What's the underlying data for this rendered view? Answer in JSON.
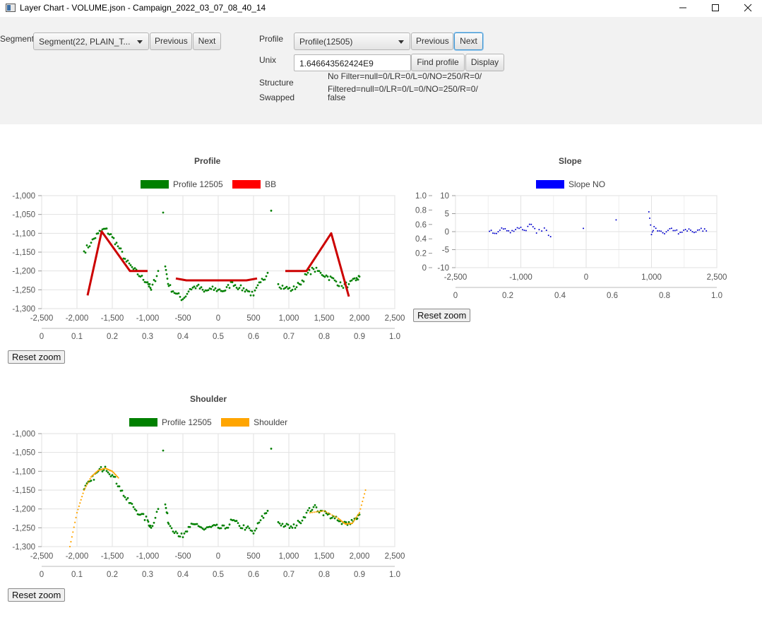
{
  "window": {
    "title": "Layer Chart - VOLUME.json - Campaign_2022_03_07_08_40_14",
    "minimize": "—",
    "maximize": "☐",
    "close": "✕"
  },
  "segment": {
    "label": "Segment",
    "selected": "Segment(22, PLAIN_T...",
    "prev": "Previous",
    "next": "Next"
  },
  "profile": {
    "label": "Profile",
    "selected": "Profile(12505)",
    "prev": "Previous",
    "next": "Next",
    "unix_label": "Unix",
    "unix_value": "1.646643562424E9",
    "find": "Find profile",
    "display": "Display",
    "structure_label": "Structure",
    "structure_line1": "No Filter=null=0/LR=0/L=0/NO=250/R=0/",
    "structure_line2": "Filtered=null=0/LR=0/L=0/NO=250/R=0/",
    "swapped_label": "Swapped",
    "swapped_value": "false"
  },
  "charts": {
    "reset_label": "Reset zoom",
    "profile": {
      "title": "Profile",
      "legend": [
        {
          "name": "Profile 12505",
          "color": "#008000"
        },
        {
          "name": "BB",
          "color": "#ff0000"
        }
      ],
      "y_ticks": [
        "-1,000",
        "-1,050",
        "-1,100",
        "-1,150",
        "-1,200",
        "-1,250",
        "-1,300"
      ],
      "x_ticks": [
        "-2,500",
        "-2,000",
        "-1,500",
        "-1,000",
        "-500",
        "0",
        "500",
        "1,000",
        "1,500",
        "2,000",
        "2,500"
      ],
      "x2_ticks": [
        "0",
        "0.1",
        "0.2",
        "0.3",
        "0.4",
        "0.5",
        "0.6",
        "0.7",
        "0.8",
        "0.9",
        "1.0"
      ]
    },
    "slope": {
      "title": "Slope",
      "legend": [
        {
          "name": "Slope NO",
          "color": "#0000ff"
        }
      ],
      "y_ticks": [
        "10",
        "5",
        "0",
        "-5",
        "-10"
      ],
      "y2_ticks": [
        "1.0",
        "0.8",
        "0.6",
        "0.4",
        "0.2",
        "0"
      ],
      "x_ticks": [
        "-2,500",
        "-1,000",
        "0",
        "1,000",
        "2,500"
      ],
      "x2_ticks": [
        "0",
        "0.2",
        "0.4",
        "0.6",
        "0.8",
        "1.0"
      ]
    },
    "shoulder": {
      "title": "Shoulder",
      "legend": [
        {
          "name": "Profile 12505",
          "color": "#008000"
        },
        {
          "name": "Shoulder",
          "color": "#ffa500"
        }
      ],
      "y_ticks": [
        "-1,000",
        "-1,050",
        "-1,100",
        "-1,150",
        "-1,200",
        "-1,250",
        "-1,300"
      ],
      "x_ticks": [
        "-2,500",
        "-2,000",
        "-1,500",
        "-1,000",
        "-500",
        "0",
        "500",
        "1,000",
        "1,500",
        "2,000",
        "2,500"
      ],
      "x2_ticks": [
        "0",
        "0.1",
        "0.2",
        "0.3",
        "0.4",
        "0.5",
        "0.6",
        "0.7",
        "0.8",
        "0.9",
        "1.0"
      ]
    }
  },
  "chart_data": [
    {
      "type": "scatter",
      "title": "Profile",
      "xlim": [
        -2500,
        2500
      ],
      "ylim": [
        -1300,
        -1000
      ],
      "series": [
        {
          "name": "Profile 12505",
          "color": "#008000",
          "kind": "scatter",
          "points": [
            [
              -1900,
              -1148
            ],
            [
              -1800,
              -1125
            ],
            [
              -1700,
              -1100
            ],
            [
              -1600,
              -1088
            ],
            [
              -1500,
              -1110
            ],
            [
              -1400,
              -1140
            ],
            [
              -1300,
              -1175
            ],
            [
              -1200,
              -1195
            ],
            [
              -1100,
              -1215
            ],
            [
              -1000,
              -1230
            ],
            [
              -950,
              -1250
            ],
            [
              -850,
              -1200
            ],
            [
              -780,
              -1045
            ],
            [
              -750,
              -1188
            ],
            [
              -700,
              -1240
            ],
            [
              -600,
              -1260
            ],
            [
              -500,
              -1275
            ],
            [
              -400,
              -1248
            ],
            [
              -300,
              -1240
            ],
            [
              -200,
              -1255
            ],
            [
              -100,
              -1248
            ],
            [
              0,
              -1250
            ],
            [
              100,
              -1252
            ],
            [
              200,
              -1230
            ],
            [
              300,
              -1245
            ],
            [
              400,
              -1250
            ],
            [
              500,
              -1265
            ],
            [
              600,
              -1230
            ],
            [
              700,
              -1205
            ],
            [
              750,
              -1040
            ],
            [
              850,
              -1235
            ],
            [
              950,
              -1245
            ],
            [
              1050,
              -1250
            ],
            [
              1150,
              -1235
            ],
            [
              1250,
              -1210
            ],
            [
              1350,
              -1195
            ],
            [
              1450,
              -1205
            ],
            [
              1550,
              -1215
            ],
            [
              1650,
              -1225
            ],
            [
              1750,
              -1240
            ],
            [
              1850,
              -1235
            ],
            [
              1950,
              -1225
            ],
            [
              2000,
              -1215
            ]
          ]
        },
        {
          "name": "BB",
          "color": "#cc0000",
          "kind": "line",
          "segments": [
            [
              [
                -1850,
                -1265
              ],
              [
                -1650,
                -1095
              ],
              [
                -1250,
                -1200
              ],
              [
                -1000,
                -1200
              ]
            ],
            [
              [
                -600,
                -1220
              ],
              [
                -450,
                -1225
              ],
              [
                400,
                -1225
              ],
              [
                550,
                -1220
              ]
            ],
            [
              [
                950,
                -1200
              ],
              [
                1250,
                -1200
              ],
              [
                1600,
                -1100
              ],
              [
                1850,
                -1268
              ]
            ]
          ]
        }
      ]
    },
    {
      "type": "scatter",
      "title": "Slope",
      "xlim": [
        -2500,
        2500
      ],
      "ylim": [
        -10,
        10
      ],
      "series": [
        {
          "name": "Slope NO",
          "color": "#0000cc",
          "kind": "scatter",
          "points": [
            [
              -1850,
              0.1
            ],
            [
              -1750,
              -0.5
            ],
            [
              -1650,
              0.4
            ],
            [
              -1550,
              0.8
            ],
            [
              -1450,
              -0.3
            ],
            [
              -1350,
              0.6
            ],
            [
              -1250,
              1.2
            ],
            [
              -1150,
              0.3
            ],
            [
              -1050,
              2.0
            ],
            [
              -950,
              -0.4
            ],
            [
              -800,
              1.0
            ],
            [
              -680,
              -1.4
            ],
            [
              1200,
              5.5
            ],
            [
              1250,
              -0.8
            ],
            [
              1300,
              1.4
            ],
            [
              1400,
              0.2
            ],
            [
              1500,
              -0.6
            ],
            [
              1600,
              0.8
            ],
            [
              1700,
              0.3
            ],
            [
              1800,
              -0.2
            ],
            [
              1900,
              0.6
            ],
            [
              2000,
              0.4
            ],
            [
              2100,
              -0.1
            ],
            [
              2200,
              0.9
            ],
            [
              2300,
              0.2
            ]
          ]
        }
      ]
    },
    {
      "type": "scatter",
      "title": "Shoulder",
      "xlim": [
        -2500,
        2500
      ],
      "ylim": [
        -1300,
        -1000
      ],
      "series": [
        {
          "name": "Profile 12505",
          "color": "#008000",
          "kind": "scatter",
          "points": [
            [
              -1900,
              -1148
            ],
            [
              -1800,
              -1125
            ],
            [
              -1700,
              -1100
            ],
            [
              -1600,
              -1088
            ],
            [
              -1500,
              -1110
            ],
            [
              -1400,
              -1140
            ],
            [
              -1300,
              -1175
            ],
            [
              -1200,
              -1195
            ],
            [
              -1100,
              -1215
            ],
            [
              -1000,
              -1230
            ],
            [
              -950,
              -1250
            ],
            [
              -850,
              -1200
            ],
            [
              -780,
              -1045
            ],
            [
              -750,
              -1188
            ],
            [
              -700,
              -1240
            ],
            [
              -600,
              -1260
            ],
            [
              -500,
              -1275
            ],
            [
              -400,
              -1248
            ],
            [
              -300,
              -1240
            ],
            [
              -200,
              -1255
            ],
            [
              -100,
              -1248
            ],
            [
              0,
              -1250
            ],
            [
              100,
              -1252
            ],
            [
              200,
              -1230
            ],
            [
              300,
              -1245
            ],
            [
              400,
              -1250
            ],
            [
              500,
              -1265
            ],
            [
              600,
              -1230
            ],
            [
              700,
              -1205
            ],
            [
              750,
              -1040
            ],
            [
              850,
              -1235
            ],
            [
              950,
              -1245
            ],
            [
              1050,
              -1250
            ],
            [
              1150,
              -1235
            ],
            [
              1250,
              -1210
            ],
            [
              1350,
              -1195
            ],
            [
              1450,
              -1205
            ],
            [
              1550,
              -1215
            ],
            [
              1650,
              -1225
            ],
            [
              1750,
              -1240
            ],
            [
              1850,
              -1235
            ],
            [
              1950,
              -1225
            ],
            [
              2000,
              -1215
            ]
          ]
        },
        {
          "name": "Shoulder",
          "color": "#ffa500",
          "kind": "dotted",
          "points": [
            [
              -2100,
              -1300
            ],
            [
              -2000,
              -1210
            ],
            [
              -1900,
              -1150
            ],
            [
              -1800,
              -1115
            ],
            [
              -1700,
              -1098
            ],
            [
              -1600,
              -1092
            ],
            [
              -1500,
              -1100
            ],
            [
              -1400,
              -1120
            ],
            [
              1300,
              -1210
            ],
            [
              1500,
              -1205
            ],
            [
              1700,
              -1225
            ],
            [
              1800,
              -1240
            ],
            [
              1900,
              -1238
            ],
            [
              2000,
              -1210
            ],
            [
              2100,
              -1140
            ]
          ]
        }
      ]
    }
  ]
}
